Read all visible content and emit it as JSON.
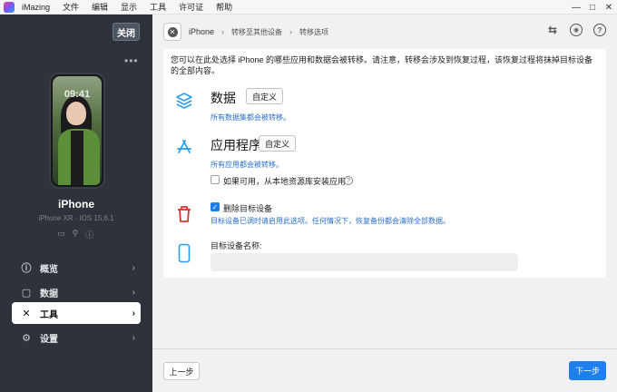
{
  "app": {
    "title": "iMazing"
  },
  "menu": [
    "文件",
    "编辑",
    "显示",
    "工具",
    "许可证",
    "帮助"
  ],
  "window_controls": {
    "minimize": "—",
    "maximize": "□",
    "close": "✕"
  },
  "sidebar": {
    "close_label": "关闭",
    "more": "•••",
    "phone_time": "09:41",
    "device_name": "iPhone",
    "device_sub": "iPhone XR · iOS 15.6.1",
    "device_icons": [
      "▭",
      "⚲",
      "ⓘ"
    ],
    "items": [
      {
        "label": "概览",
        "icon": "ⓘ",
        "chev": "›"
      },
      {
        "label": "数据",
        "icon": "▢",
        "chev": "›"
      },
      {
        "label": "工具",
        "icon": "✕",
        "chev": "›"
      },
      {
        "label": "设置",
        "icon": "⚙",
        "chev": "›"
      }
    ]
  },
  "topbar": {
    "device": "iPhone",
    "crumb_sep": "›",
    "crumbs": [
      "转移至其他设备",
      "转移选项"
    ],
    "icons": {
      "swap": "⇆",
      "account": "◉",
      "help": "?"
    }
  },
  "main": {
    "intro": "您可以在此处选择 iPhone 的哪些应用和数据会被转移。请注意，转移会涉及到恢复过程，该恢复过程将抹掉目标设备的全部内容。",
    "data_title": "数据",
    "data_custom": "自定义",
    "data_desc": "所有数据集都会被转移。",
    "apps_title": "应用程序",
    "apps_custom": "自定义",
    "apps_desc": "所有应用都会被转移。",
    "local_lib_label": "如果可用，从本地资源库安装应用",
    "local_lib_help": "?",
    "erase_label": "删除目标设备",
    "erase_desc": "目标设备已调时请启用此选项。任何情况下，恢复备份都会清除全部数据。",
    "target_name_label": "目标设备名称:",
    "target_name_value": ""
  },
  "footer": {
    "prev": "上一步",
    "next": "下一步"
  },
  "colors": {
    "accent": "#1d7ff0",
    "sidebar": "#2e333b",
    "trash": "#e0322b",
    "sky": "#2a9df4"
  }
}
